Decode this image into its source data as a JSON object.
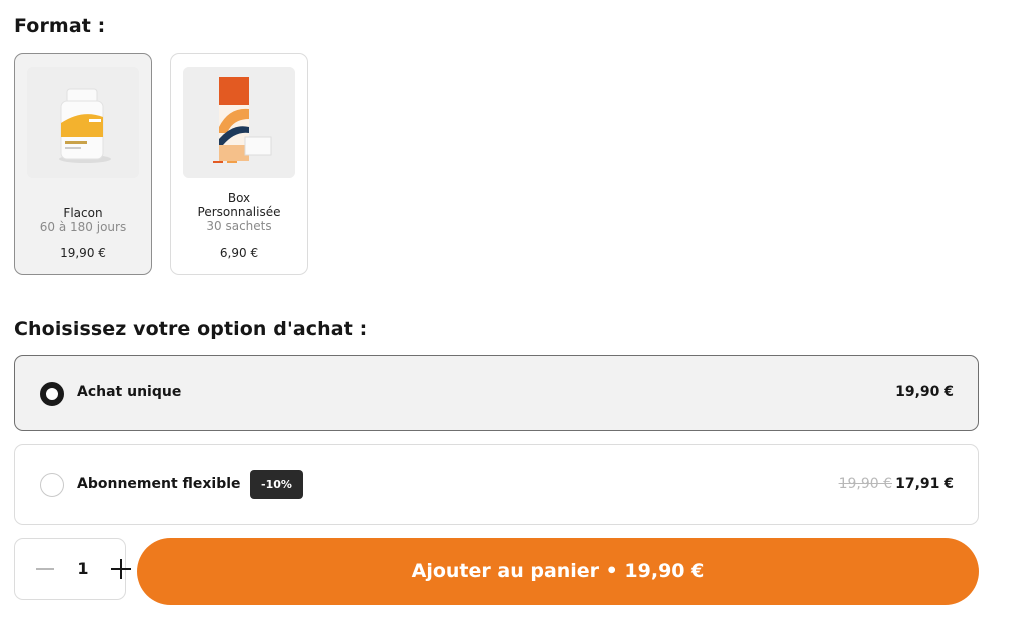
{
  "format": {
    "title": "Format :",
    "cards": [
      {
        "name": "Flacon",
        "sub": "60 à 180 jours",
        "price": "19,90 €",
        "selected": true
      },
      {
        "name_line1": "Box",
        "name_line2": "Personnalisée",
        "sub": "30 sachets",
        "price": "6,90 €",
        "selected": false
      }
    ]
  },
  "purchase": {
    "title": "Choisissez votre option d'achat :",
    "options": [
      {
        "label": "Achat unique",
        "price": "19,90 €",
        "selected": true
      },
      {
        "label": "Abonnement flexible",
        "badge": "-10%",
        "old_price": "19,90 €",
        "price": "17,91 €",
        "selected": false
      }
    ]
  },
  "cart": {
    "quantity": "1",
    "button_label": "Ajouter au panier • 19,90 €"
  },
  "colors": {
    "accent": "#ee7a1d",
    "selected_bg": "#f2f2f2",
    "badge_bg": "#2a2a2a"
  }
}
